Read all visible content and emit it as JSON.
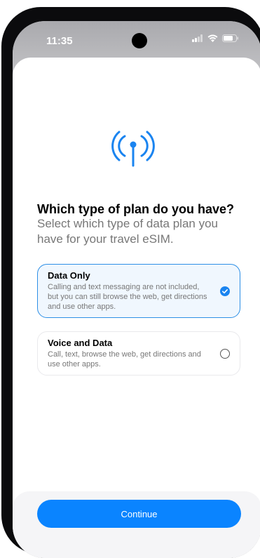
{
  "status_bar": {
    "time": "11:35",
    "icons": [
      "cellular-icon",
      "wifi-icon",
      "battery-icon"
    ]
  },
  "hero_icon": "antenna-signal-icon",
  "title": "Which type of plan do you have?",
  "subtitle": "Select which type of data plan you have for your travel eSIM.",
  "options": [
    {
      "title": "Data Only",
      "description": "Calling and text messaging are not included, but you can still browse the web, get directions and use other apps.",
      "selected": true
    },
    {
      "title": "Voice and Data",
      "description": "Call, text, browse the web, get directions and use other apps.",
      "selected": false
    }
  ],
  "continue_label": "Continue",
  "colors": {
    "accent": "#0a84ff",
    "selected_border": "#2d8fe6",
    "selected_bg": "#f0f7fe",
    "text_secondary": "#777777"
  }
}
